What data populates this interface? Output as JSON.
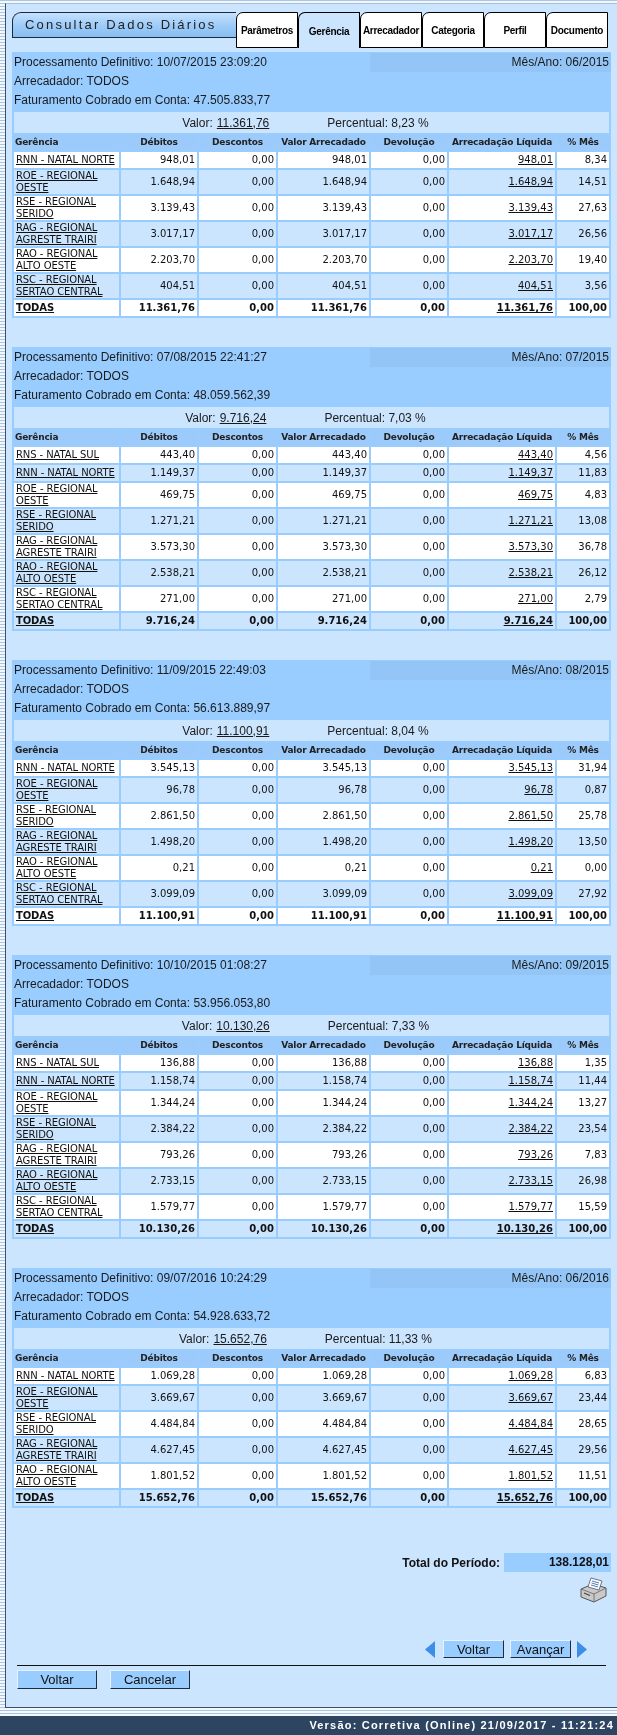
{
  "title": "Consultar Dados Diários",
  "tabs": [
    {
      "label": "Parâmetros",
      "selected": false
    },
    {
      "label": "Gerência",
      "selected": true
    },
    {
      "label": "Arrecadador",
      "selected": false
    },
    {
      "label": "Categoria",
      "selected": false
    },
    {
      "label": "Perfil",
      "selected": false
    },
    {
      "label": "Documento",
      "selected": false
    }
  ],
  "sections": [
    {
      "processamento": "Processamento Definitivo: 10/07/2015 23:09:20",
      "mes_ano": "Mês/Ano: 06/2015",
      "arrecadador": "Arrecadador: TODOS",
      "faturamento": "Faturamento Cobrado em Conta: 47.505.833,77",
      "valor_label": "Valor:",
      "valor": "11.361,76",
      "percentual": "Percentual: 8,23 %",
      "columns": [
        "Gerência",
        "Débitos",
        "Descontos",
        "Valor Arrecadado",
        "Devolução",
        "Arrecadação Líquida",
        "% Mês"
      ],
      "rows": [
        [
          "RNN - NATAL NORTE",
          "948,01",
          "0,00",
          "948,01",
          "0,00",
          "948,01",
          "8,34"
        ],
        [
          "ROE - REGIONAL OESTE",
          "1.648,94",
          "0,00",
          "1.648,94",
          "0,00",
          "1.648,94",
          "14,51"
        ],
        [
          "RSE - REGIONAL SERIDO",
          "3.139,43",
          "0,00",
          "3.139,43",
          "0,00",
          "3.139,43",
          "27,63"
        ],
        [
          "RAG - REGIONAL AGRESTE TRAIRI",
          "3.017,17",
          "0,00",
          "3.017,17",
          "0,00",
          "3.017,17",
          "26,56"
        ],
        [
          "RAO - REGIONAL ALTO OESTE",
          "2.203,70",
          "0,00",
          "2.203,70",
          "0,00",
          "2.203,70",
          "19,40"
        ],
        [
          "RSC - REGIONAL SERTAO CENTRAL",
          "404,51",
          "0,00",
          "404,51",
          "0,00",
          "404,51",
          "3,56"
        ]
      ],
      "total": [
        "TODAS",
        "11.361,76",
        "0,00",
        "11.361,76",
        "0,00",
        "11.361,76",
        "100,00"
      ]
    },
    {
      "processamento": "Processamento Definitivo: 07/08/2015 22:41:27",
      "mes_ano": "Mês/Ano: 07/2015",
      "arrecadador": "Arrecadador: TODOS",
      "faturamento": "Faturamento Cobrado em Conta: 48.059.562,39",
      "valor_label": "Valor:",
      "valor": "9.716,24",
      "percentual": "Percentual: 7,03 %",
      "columns": [
        "Gerência",
        "Débitos",
        "Descontos",
        "Valor Arrecadado",
        "Devolução",
        "Arrecadação Líquida",
        "% Mês"
      ],
      "rows": [
        [
          "RNS - NATAL SUL",
          "443,40",
          "0,00",
          "443,40",
          "0,00",
          "443,40",
          "4,56"
        ],
        [
          "RNN - NATAL NORTE",
          "1.149,37",
          "0,00",
          "1.149,37",
          "0,00",
          "1.149,37",
          "11,83"
        ],
        [
          "ROE - REGIONAL OESTE",
          "469,75",
          "0,00",
          "469,75",
          "0,00",
          "469,75",
          "4,83"
        ],
        [
          "RSE - REGIONAL SERIDO",
          "1.271,21",
          "0,00",
          "1.271,21",
          "0,00",
          "1.271,21",
          "13,08"
        ],
        [
          "RAG - REGIONAL AGRESTE TRAIRI",
          "3.573,30",
          "0,00",
          "3.573,30",
          "0,00",
          "3.573,30",
          "36,78"
        ],
        [
          "RAO - REGIONAL ALTO OESTE",
          "2.538,21",
          "0,00",
          "2.538,21",
          "0,00",
          "2.538,21",
          "26,12"
        ],
        [
          "RSC - REGIONAL SERTAO CENTRAL",
          "271,00",
          "0,00",
          "271,00",
          "0,00",
          "271,00",
          "2,79"
        ]
      ],
      "total": [
        "TODAS",
        "9.716,24",
        "0,00",
        "9.716,24",
        "0,00",
        "9.716,24",
        "100,00"
      ]
    },
    {
      "processamento": "Processamento Definitivo: 11/09/2015 22:49:03",
      "mes_ano": "Mês/Ano: 08/2015",
      "arrecadador": "Arrecadador: TODOS",
      "faturamento": "Faturamento Cobrado em Conta: 56.613.889,97",
      "valor_label": "Valor:",
      "valor": "11.100,91",
      "percentual": "Percentual: 8,04 %",
      "columns": [
        "Gerência",
        "Débitos",
        "Descontos",
        "Valor Arrecadado",
        "Devolução",
        "Arrecadação Líquida",
        "% Mês"
      ],
      "rows": [
        [
          "RNN - NATAL NORTE",
          "3.545,13",
          "0,00",
          "3.545,13",
          "0,00",
          "3.545,13",
          "31,94"
        ],
        [
          "ROE - REGIONAL OESTE",
          "96,78",
          "0,00",
          "96,78",
          "0,00",
          "96,78",
          "0,87"
        ],
        [
          "RSE - REGIONAL SERIDO",
          "2.861,50",
          "0,00",
          "2.861,50",
          "0,00",
          "2.861,50",
          "25,78"
        ],
        [
          "RAG - REGIONAL AGRESTE TRAIRI",
          "1.498,20",
          "0,00",
          "1.498,20",
          "0,00",
          "1.498,20",
          "13,50"
        ],
        [
          "RAO - REGIONAL ALTO OESTE",
          "0,21",
          "0,00",
          "0,21",
          "0,00",
          "0,21",
          "0,00"
        ],
        [
          "RSC - REGIONAL SERTAO CENTRAL",
          "3.099,09",
          "0,00",
          "3.099,09",
          "0,00",
          "3.099,09",
          "27,92"
        ]
      ],
      "total": [
        "TODAS",
        "11.100,91",
        "0,00",
        "11.100,91",
        "0,00",
        "11.100,91",
        "100,00"
      ]
    },
    {
      "processamento": "Processamento Definitivo: 10/10/2015 01:08:27",
      "mes_ano": "Mês/Ano: 09/2015",
      "arrecadador": "Arrecadador: TODOS",
      "faturamento": "Faturamento Cobrado em Conta: 53.956.053,80",
      "valor_label": "Valor:",
      "valor": "10.130,26",
      "percentual": "Percentual: 7,33 %",
      "columns": [
        "Gerência",
        "Débitos",
        "Descontos",
        "Valor Arrecadado",
        "Devolução",
        "Arrecadação Líquida",
        "% Mês"
      ],
      "rows": [
        [
          "RNS - NATAL SUL",
          "136,88",
          "0,00",
          "136,88",
          "0,00",
          "136,88",
          "1,35"
        ],
        [
          "RNN - NATAL NORTE",
          "1.158,74",
          "0,00",
          "1.158,74",
          "0,00",
          "1.158,74",
          "11,44"
        ],
        [
          "ROE - REGIONAL OESTE",
          "1.344,24",
          "0,00",
          "1.344,24",
          "0,00",
          "1.344,24",
          "13,27"
        ],
        [
          "RSE - REGIONAL SERIDO",
          "2.384,22",
          "0,00",
          "2.384,22",
          "0,00",
          "2.384,22",
          "23,54"
        ],
        [
          "RAG - REGIONAL AGRESTE TRAIRI",
          "793,26",
          "0,00",
          "793,26",
          "0,00",
          "793,26",
          "7,83"
        ],
        [
          "RAO - REGIONAL ALTO OESTE",
          "2.733,15",
          "0,00",
          "2.733,15",
          "0,00",
          "2.733,15",
          "26,98"
        ],
        [
          "RSC - REGIONAL SERTAO CENTRAL",
          "1.579,77",
          "0,00",
          "1.579,77",
          "0,00",
          "1.579,77",
          "15,59"
        ]
      ],
      "total": [
        "TODAS",
        "10.130,26",
        "0,00",
        "10.130,26",
        "0,00",
        "10.130,26",
        "100,00"
      ]
    },
    {
      "processamento": "Processamento Definitivo: 09/07/2016 10:24:29",
      "mes_ano": "Mês/Ano: 06/2016",
      "arrecadador": "Arrecadador: TODOS",
      "faturamento": "Faturamento Cobrado em Conta: 54.928.633,72",
      "valor_label": "Valor:",
      "valor": "15.652,76",
      "percentual": "Percentual: 11,33 %",
      "columns": [
        "Gerência",
        "Débitos",
        "Descontos",
        "Valor Arrecadado",
        "Devolução",
        "Arrecadação Líquida",
        "% Mês"
      ],
      "rows": [
        [
          "RNN - NATAL NORTE",
          "1.069,28",
          "0,00",
          "1.069,28",
          "0,00",
          "1.069,28",
          "6,83"
        ],
        [
          "ROE - REGIONAL OESTE",
          "3.669,67",
          "0,00",
          "3.669,67",
          "0,00",
          "3.669,67",
          "23,44"
        ],
        [
          "RSE - REGIONAL SERIDO",
          "4.484,84",
          "0,00",
          "4.484,84",
          "0,00",
          "4.484,84",
          "28,65"
        ],
        [
          "RAG - REGIONAL AGRESTE TRAIRI",
          "4.627,45",
          "0,00",
          "4.627,45",
          "0,00",
          "4.627,45",
          "29,56"
        ],
        [
          "RAO - REGIONAL ALTO OESTE",
          "1.801,52",
          "0,00",
          "1.801,52",
          "0,00",
          "1.801,52",
          "11,51"
        ]
      ],
      "total": [
        "TODAS",
        "15.652,76",
        "0,00",
        "15.652,76",
        "0,00",
        "15.652,76",
        "100,00"
      ]
    }
  ],
  "total_periodo": {
    "label": "Total do Período:",
    "value": "138.128,01"
  },
  "navigation": {
    "back": "Voltar",
    "next": "Avançar"
  },
  "form_buttons": {
    "back": "Voltar",
    "cancel": "Cancelar"
  },
  "status_bar": "Versão: Corretiva (Online) 21/09/2017 - 11:21:24"
}
